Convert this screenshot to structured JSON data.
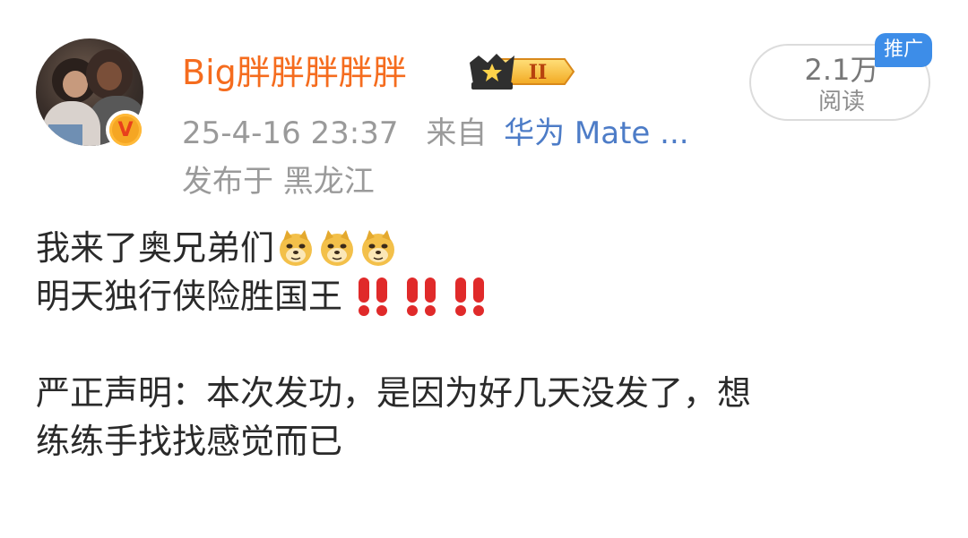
{
  "post": {
    "username": "Big胖胖胖胖胖",
    "timestamp": "25-4-16 23:37",
    "source_prefix": "来自",
    "source_device": "华为 Mate ...",
    "location": "发布于 黑龙江",
    "reads_count": "2.1万",
    "reads_label": "阅读",
    "ad_tag": "推广",
    "level_roman": "II",
    "verified_mark": "V",
    "content": {
      "line1": "我来了奥兄弟们",
      "line2": "明天独行侠险胜国王",
      "line3": "严正声明：本次发功，是因为好几天没发了，想",
      "line4": "练练手找找感觉而已"
    },
    "emojis": {
      "line1": [
        "doge-emoji",
        "doge-emoji",
        "doge-emoji"
      ],
      "line2": [
        "double-exclamation-emoji",
        "double-exclamation-emoji",
        "double-exclamation-emoji"
      ]
    }
  },
  "colors": {
    "username": "#f56c1e",
    "meta": "#9a9a9a",
    "device_link": "#4d7cc7",
    "ad_tag_bg": "#3d8de8",
    "verified_badge": "#f5a623",
    "text": "#2a2a2a"
  }
}
